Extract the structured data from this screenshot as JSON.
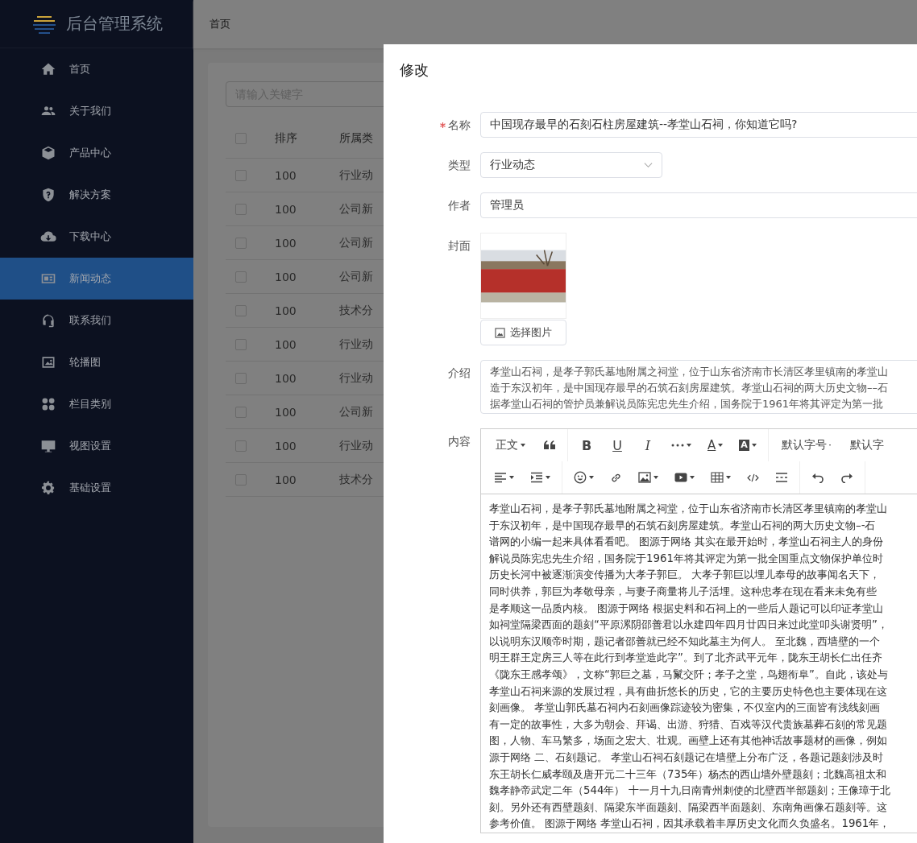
{
  "sidebar": {
    "title": "后台管理系统",
    "items": [
      {
        "label": "首页",
        "selected": false
      },
      {
        "label": "关于我们",
        "selected": false
      },
      {
        "label": "产品中心",
        "selected": false
      },
      {
        "label": "解决方案",
        "selected": false
      },
      {
        "label": "下载中心",
        "selected": false
      },
      {
        "label": "新闻动态",
        "selected": true
      },
      {
        "label": "联系我们",
        "selected": false
      },
      {
        "label": "轮播图",
        "selected": false
      },
      {
        "label": "栏目类别",
        "selected": false
      },
      {
        "label": "视图设置",
        "selected": false
      },
      {
        "label": "基础设置",
        "selected": false
      }
    ]
  },
  "breadcrumb": "首页",
  "search": {
    "placeholder": "请输入关键字"
  },
  "table": {
    "all_checked": false,
    "columns": [
      "排序",
      "所属类"
    ],
    "rows": [
      {
        "checked": false,
        "cells": [
          "100",
          "行业动"
        ]
      },
      {
        "checked": false,
        "cells": [
          "100",
          "公司新"
        ]
      },
      {
        "checked": false,
        "cells": [
          "100",
          "公司新"
        ]
      },
      {
        "checked": false,
        "cells": [
          "100",
          "公司新"
        ]
      },
      {
        "checked": false,
        "cells": [
          "100",
          "技术分"
        ]
      },
      {
        "checked": false,
        "cells": [
          "100",
          "行业动"
        ]
      },
      {
        "checked": false,
        "cells": [
          "100",
          "行业动"
        ]
      },
      {
        "checked": false,
        "cells": [
          "100",
          "公司新"
        ]
      },
      {
        "checked": false,
        "cells": [
          "100",
          "行业动"
        ]
      },
      {
        "checked": false,
        "cells": [
          "100",
          "技术分"
        ]
      }
    ]
  },
  "drawer": {
    "title": "修改",
    "name": {
      "label": "名称",
      "required": true,
      "value": "中国现存最早的石刻石柱房屋建筑--孝堂山石祠，你知道它吗?"
    },
    "type": {
      "label": "类型",
      "value": "行业动态"
    },
    "author": {
      "label": "作者",
      "value": "管理员"
    },
    "cover": {
      "label": "封面",
      "button": "选择图片"
    },
    "intro": {
      "label": "介绍",
      "lines": [
        "孝堂山石祠，是孝子郭氏墓地附属之祠堂，位于山东省济南市长清区孝里镇南的孝堂山",
        "造于东汉初年，是中国现存最早的石筑石刻房屋建筑。孝堂山石祠的两大历史文物––石",
        "据孝堂山石祠的管护员兼解说员陈宪忠先生介绍，国务院于1961年将其评定为第一批"
      ]
    },
    "content": {
      "label": "内容",
      "toolbar": {
        "selects": [
          "正文",
          "默认字号",
          "默认字"
        ],
        "format_buttons": [
          {
            "kind": "bold",
            "label": "B"
          },
          {
            "kind": "underline",
            "label": "U"
          },
          {
            "kind": "italic",
            "label": "I"
          }
        ],
        "color_buttons": [
          {
            "kind": "font",
            "label": "A"
          },
          {
            "kind": "background",
            "label": "A"
          }
        ]
      },
      "lines": [
        "孝堂山石祠，是孝子郭氏墓地附属之祠堂，位于山东省济南市长清区孝里镇南的孝堂山",
        "于东汉初年，是中国现存最早的石筑石刻房屋建筑。孝堂山石祠的两大历史文物–-石",
        "谱网的小编一起来具体看看吧。 图源于网络 其实在最开始时，孝堂山石祠主人的身份",
        "解说员陈宪忠先生介绍，国务院于1961年将其评定为第一批全国重点文物保护单位时",
        "历史长河中被逐渐演变传播为大孝子郭巨。 大孝子郭巨以埋儿奉母的故事闻名天下，",
        "同时供养，郭巨为孝敬母亲，与妻子商量将儿子活埋。这种忠孝在现在看来未免有些",
        "是孝顺这一品质内核。 图源于网络 根据史料和石祠上的一些后人题记可以印证孝堂山",
        "如祠堂隔梁西面的题刻“平原漯阴邵善君以永建四年四月廿四日来过此堂叩头谢贤明”，",
        "以说明东汉顺帝时期，题记者邵善就已经不知此墓主为何人。 至北魏，西墙壁的一个",
        "明王群王定房三人等在此行到孝堂造此字”。到了北齐武平元年，陇东王胡长仁出任齐",
        "《陇东王感孝颂》，文称“郭巨之墓，马鬣交阡；孝子之堂，鸟翅衔阜”。自此，该处与",
        "孝堂山石祠来源的发展过程，具有曲折悠长的历史，它的主要历史特色也主要体现在这",
        "刻画像。 孝堂山郭氏墓石祠内石刻画像踪迹较为密集，不仅室内的三面皆有浅线刻画",
        "有一定的故事性，大多为朝会、拜谒、出游、狩猎、百戏等汉代贵族墓葬石刻的常见题",
        "图，人物、车马繁多，场面之宏大、壮观。画壁上还有其他神话故事题材的画像，例如",
        "源于网络 二、石刻题记。 孝堂山石祠石刻题记在墙壁上分布广泛，各题记题刻涉及时",
        "东王胡长仁威孝颐及唐开元二十三年（735年）杨杰的西山墙外壁题刻；北魏高祖太和",
        "魏孝静帝武定二年（544年） 十一月十九日南青州刺使的北壁西半部题刻；王像璋于北",
        "刻。另外还有西壁题刻、隔梁东半面题刻、隔梁西半面题刻、东南角画像石题刻等。这",
        "参考价值。 图源于网络 孝堂山石祠，因其承载着丰厚历史文化而久负盛名。1961年，"
      ]
    }
  }
}
